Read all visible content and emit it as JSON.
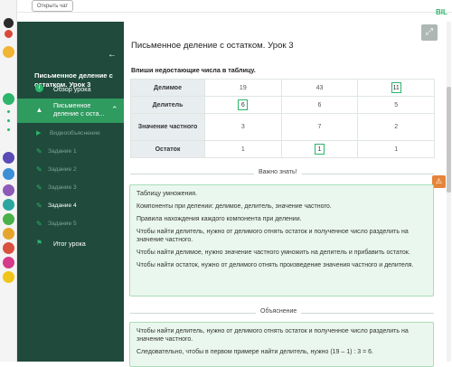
{
  "topbar": {
    "open_chat": "Открыть чат",
    "logo": "BIL"
  },
  "sidebar": {
    "course_title": "Письменное деление с остатком. Урок 3",
    "items": [
      {
        "label": "Обзор урока",
        "icon": "info-icon"
      },
      {
        "label": "Письменное деление с оста...",
        "icon": "graduation-cap-icon"
      }
    ],
    "subitems": [
      {
        "label": "Видеообъяснение",
        "icon": "play-icon"
      },
      {
        "label": "Задание 1",
        "icon": "edit-icon"
      },
      {
        "label": "Задание 2",
        "icon": "edit-icon"
      },
      {
        "label": "Задание 3",
        "icon": "edit-icon"
      },
      {
        "label": "Задание 4",
        "icon": "edit-icon"
      },
      {
        "label": "Задание 5",
        "icon": "edit-icon"
      }
    ],
    "final": {
      "label": "Итог урока",
      "icon": "flag-icon"
    }
  },
  "main": {
    "title": "Письменное деление с остатком. Урок 3",
    "task": "Впиши недостающие числа в таблицу.",
    "table": {
      "rows": [
        {
          "header": "Делимое",
          "cells": [
            "19",
            "43",
            "11"
          ],
          "answer_col": 2
        },
        {
          "header": "Делитель",
          "cells": [
            "6",
            "6",
            "5"
          ],
          "answer_col": 0
        },
        {
          "header": "Значение частного",
          "cells": [
            "3",
            "7",
            "2"
          ],
          "answer_col": -1
        },
        {
          "header": "Остаток",
          "cells": [
            "1",
            "1",
            "1"
          ],
          "answer_col": 1
        }
      ]
    },
    "important_label": "Важно знать!",
    "important": [
      "Таблицу умножения.",
      "Компоненты при делении: делимое, делитель, значение частного.",
      "Правила нахождения каждого компонента при делении.",
      "Чтобы найти делитель, нужно от делимого отнять остаток и полученное число разделить на значение частного.",
      "Чтобы найти делимое, нужно значение частного умножить на делитель и прибавить остаток.",
      "Чтобы найти остаток, нужно от делимого отнять произведение значения частного и делителя."
    ],
    "explanation_label": "Объяснение",
    "explanation": [
      "Чтобы найти делитель, нужно от делимого отнять остаток и полученное число разделить на значение частного.",
      "Следовательно, чтобы в первом примере найти делитель, нужно (19 – 1) : 3 = 6."
    ]
  }
}
